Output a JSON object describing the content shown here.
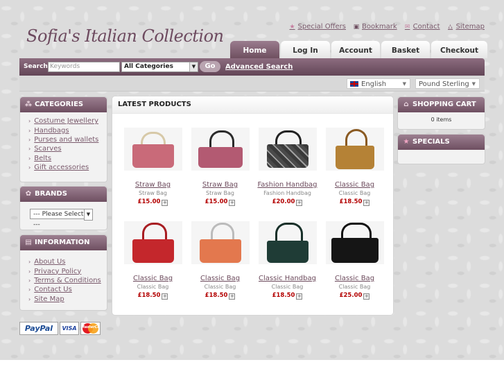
{
  "site": {
    "logo_text": "Sofia's Italian Collection"
  },
  "top_links": [
    {
      "label": "Special Offers",
      "icon": "star-icon"
    },
    {
      "label": "Bookmark",
      "icon": "bookmark-icon"
    },
    {
      "label": "Contact",
      "icon": "mail-icon"
    },
    {
      "label": "Sitemap",
      "icon": "sitemap-icon"
    }
  ],
  "tabs": [
    "Home",
    "Log In",
    "Account",
    "Basket",
    "Checkout"
  ],
  "active_tab": "Home",
  "search": {
    "label": "Search:",
    "placeholder": "Keywords",
    "category_value": "All Categories",
    "go_label": "Go",
    "advanced_label": "Advanced Search"
  },
  "locale": {
    "language": "English",
    "currency": "Pound Sterling"
  },
  "categories": {
    "title": "CATEGORIES",
    "items": [
      "Costume Jewellery",
      "Handbags",
      "Purses and wallets",
      "Scarves",
      "Belts",
      "Gift accessories"
    ]
  },
  "brands": {
    "title": "BRANDS",
    "select_value": "--- Please Select ---"
  },
  "information": {
    "title": "INFORMATION",
    "items": [
      "About Us",
      "Privacy Policy",
      "Terms & Conditions",
      "Contact Us",
      "Site Map"
    ]
  },
  "main": {
    "title": "LATEST PRODUCTS",
    "products": [
      {
        "name": "Straw Bag",
        "desc": "Straw Bag",
        "price": "£15.00",
        "color": "#c96a79"
      },
      {
        "name": "Straw Bag",
        "desc": "Straw Bag",
        "price": "£15.00",
        "color": "#b35a72"
      },
      {
        "name": "Fashion Handbag",
        "desc": "Fashion Handbag",
        "price": "£20.00",
        "color": "#4a4a4a"
      },
      {
        "name": "Classic Bag",
        "desc": "Classic Bag",
        "price": "£18.50",
        "color": "#b58236"
      },
      {
        "name": "Classic Bag",
        "desc": "Classic Bag",
        "price": "£18.50",
        "color": "#c4272c"
      },
      {
        "name": "Classic Bag",
        "desc": "Classic Bag",
        "price": "£18.50",
        "color": "#e3784e"
      },
      {
        "name": "Classic Handbag",
        "desc": "Classic Bag",
        "price": "£18.50",
        "color": "#1f3c36"
      },
      {
        "name": "Classic Bag",
        "desc": "Classic Bag",
        "price": "£25.00",
        "color": "#151515"
      }
    ]
  },
  "cart": {
    "title": "SHOPPING CART",
    "status": "0 items"
  },
  "specials": {
    "title": "SPECIALS"
  },
  "payment": {
    "paypal": "PayPal",
    "visa": "VISA",
    "mastercard": "MasterCard"
  },
  "colors": {
    "accent": "#6e4f61",
    "link": "#7a5a6c",
    "price": "#b30000"
  }
}
